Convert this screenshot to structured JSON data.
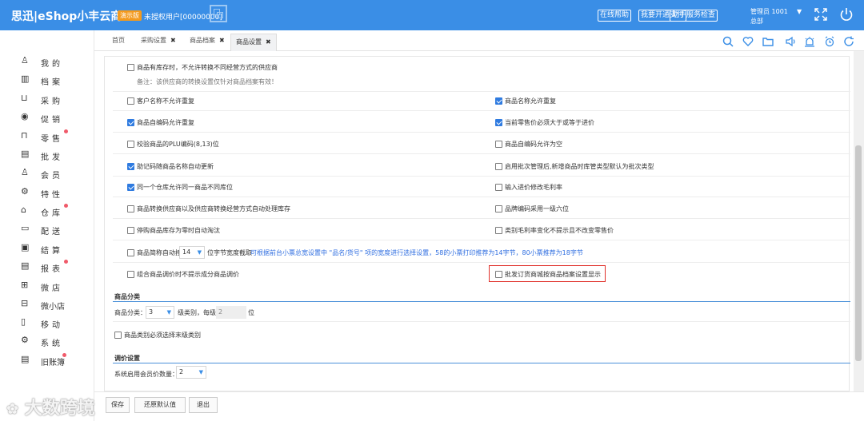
{
  "header": {
    "brand": "思迅|eShop小丰云商6",
    "badge": "演示版",
    "auth_status": "未授权用户[00000000]",
    "buttons": [
      "在线帮助",
      "我要开通支付",
      "助手服务检查"
    ],
    "admin_line1": "管理员 1001",
    "admin_line2": "总部",
    "colors": {
      "bar": "#3a8ee6",
      "badge": "#f39a1e"
    }
  },
  "sidebar": {
    "items": [
      {
        "label": "我的",
        "icon": "user-icon",
        "dot": false
      },
      {
        "label": "档案",
        "icon": "archive-icon",
        "dot": false
      },
      {
        "label": "采购",
        "icon": "basket-icon",
        "dot": false
      },
      {
        "label": "促销",
        "icon": "eye-icon",
        "dot": false
      },
      {
        "label": "零售",
        "icon": "bag-icon",
        "dot": true
      },
      {
        "label": "批发",
        "icon": "document-icon",
        "dot": false
      },
      {
        "label": "会员",
        "icon": "member-icon",
        "dot": false
      },
      {
        "label": "特性",
        "icon": "gear-icon",
        "dot": false
      },
      {
        "label": "仓库",
        "icon": "warehouse-icon",
        "dot": true
      },
      {
        "label": "配送",
        "icon": "truck-icon",
        "dot": false
      },
      {
        "label": "结算",
        "icon": "settlement-icon",
        "dot": false
      },
      {
        "label": "报表",
        "icon": "report-icon",
        "dot": true
      },
      {
        "label": "微店",
        "icon": "shop-icon",
        "dot": false
      },
      {
        "label": "微小店",
        "icon": "mini-shop-icon",
        "dot": false
      },
      {
        "label": "移动",
        "icon": "mobile-icon",
        "dot": false
      },
      {
        "label": "系统",
        "icon": "settings-icon",
        "dot": false
      },
      {
        "label": "旧账簿",
        "icon": "ledger-icon",
        "dot": true
      }
    ]
  },
  "tabs": [
    {
      "label": "首页",
      "closable": false,
      "active": false
    },
    {
      "label": "采购设置",
      "closable": true,
      "active": false
    },
    {
      "label": "商品档案",
      "closable": true,
      "active": false
    },
    {
      "label": "商品设置",
      "closable": true,
      "active": true
    }
  ],
  "toolbar_icons": [
    "search-icon",
    "heart-icon",
    "folder-open-icon",
    "folder-icon",
    "speaker-icon",
    "alert-icon",
    "alarm-icon",
    "refresh-icon"
  ],
  "settings": {
    "top_option": {
      "label": "商品有库存时，不允许转换不同经营方式的供应商",
      "checked": false
    },
    "top_note": "备注：该供应商的转换设置仅针对商品档案有效！",
    "rows": [
      [
        {
          "label": "客户名称不允许重复",
          "checked": false
        },
        {
          "label": "商品名称允许重复",
          "checked": true
        }
      ],
      [
        {
          "label": "商品自编码允许重复",
          "checked": true
        },
        {
          "label": "当前零售价必须大于或等于进价",
          "checked": true
        }
      ],
      [
        {
          "label": "校验商品的PLU编码(8,13)位",
          "checked": false
        },
        {
          "label": "商品自编码允许为空",
          "checked": false
        }
      ],
      [
        {
          "label": "助记码随商品名称自动更新",
          "checked": true
        },
        {
          "label": "启用批次管理后,新增商品时库管类型默认为批次类型",
          "checked": false
        }
      ],
      [
        {
          "label": "同一个仓库允许同一商品不同库位",
          "checked": true
        },
        {
          "label": "输入进价修改毛利率",
          "checked": false
        }
      ],
      [
        {
          "label": "商品转换供应商以及供应商转换经营方式自动处理库存",
          "checked": false
        },
        {
          "label": "品牌编码采用一级六位",
          "checked": false
        }
      ],
      [
        {
          "label": "停购商品库存为零时自动淘汰",
          "checked": false
        },
        {
          "label": "类别毛利率变化不提示且不改变零售价",
          "checked": false
        }
      ]
    ],
    "short_name": {
      "label_before": "商品简称自动按",
      "value": "14",
      "label_after": "位字节宽度截取",
      "hint": "可根据前台小票总宽设置中 \"品名/货号\" 项的宽度进行选择设置，58的小票打印推荐为14字节，80小票推荐为18字节"
    },
    "last_row": [
      {
        "label": "组合商品调价时不提示成分商品调价",
        "checked": false
      },
      {
        "label": "批发订货商城按商品档案设置显示",
        "checked": false
      }
    ],
    "category": {
      "title": "商品分类",
      "label": "商品分类：",
      "levels": "3",
      "mid_text": "级类别，每级",
      "digits": "2",
      "unit": "位",
      "must_last": {
        "label": "商品类别必须选择末级类别",
        "checked": false
      }
    },
    "price": {
      "title": "调价设置",
      "label": "系统启用会员价数量：",
      "value": "2"
    }
  },
  "footer": {
    "buttons": [
      "保存",
      "还原默认值",
      "退出"
    ]
  },
  "watermark": "大数跨境"
}
